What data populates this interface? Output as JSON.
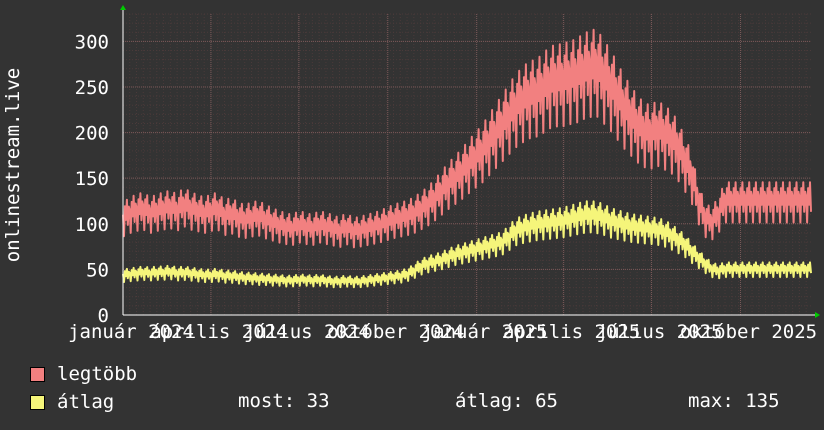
{
  "chart_data": {
    "type": "line",
    "ylabel": "onlinestream.live",
    "yticks": [
      0,
      50,
      100,
      150,
      200,
      250,
      300
    ],
    "ylim": [
      0,
      330
    ],
    "xticks": [
      "január 2024",
      "április 2024",
      "július 2024",
      "október 2024",
      "január 2025",
      "április 2025",
      "július 2025",
      "október 2025"
    ],
    "x_start": "2024-01-01",
    "x_end": "2025-12-13",
    "grid": true,
    "legend_placement": "bottom-left",
    "colors": {
      "legtobb": "#f28080",
      "atlag": "#f5f57a",
      "grid": "#5a4848",
      "minor_grid": "#4a3a3a",
      "axis": "#ffffff",
      "arrow": "#00cc00"
    },
    "series": [
      {
        "name": "legtöbb",
        "weekly_values": [
          110,
          115,
          118,
          120,
          115,
          118,
          120,
          122,
          118,
          125,
          120,
          118,
          115,
          118,
          120,
          112,
          115,
          110,
          108,
          110,
          112,
          108,
          105,
          102,
          100,
          98,
          102,
          100,
          98,
          102,
          100,
          98,
          95,
          100,
          95,
          96,
          98,
          100,
          102,
          105,
          108,
          110,
          112,
          115,
          120,
          125,
          132,
          140,
          148,
          155,
          162,
          170,
          178,
          185,
          195,
          205,
          215,
          225,
          235,
          242,
          248,
          250,
          255,
          262,
          265,
          265,
          268,
          270,
          275,
          278,
          280,
          270,
          260,
          248,
          235,
          225,
          215,
          208,
          205,
          210,
          205,
          200,
          190,
          175,
          160,
          130,
          110,
          105,
          115,
          130
        ]
      },
      {
        "name": "átlag",
        "weekly_values": [
          45,
          46,
          47,
          48,
          47,
          48,
          48,
          49,
          47,
          48,
          47,
          46,
          45,
          45,
          46,
          44,
          44,
          43,
          42,
          42,
          41,
          41,
          40,
          40,
          39,
          39,
          40,
          40,
          39,
          40,
          39,
          38,
          38,
          39,
          38,
          38,
          39,
          40,
          41,
          42,
          43,
          44,
          46,
          50,
          55,
          58,
          60,
          62,
          65,
          68,
          70,
          72,
          74,
          76,
          78,
          80,
          82,
          88,
          95,
          98,
          100,
          102,
          103,
          104,
          105,
          106,
          108,
          110,
          112,
          113,
          112,
          110,
          106,
          104,
          102,
          100,
          99,
          98,
          97,
          96,
          94,
          90,
          85,
          80,
          72,
          65,
          58,
          52,
          50,
          52
        ]
      }
    ]
  },
  "legend": {
    "items": [
      {
        "label": "legtöbb",
        "color": "#f28080"
      },
      {
        "label": "átlag",
        "color": "#f5f57a"
      }
    ]
  },
  "stats": {
    "most": "most: 33",
    "atlag": "átlag: 65",
    "max": "max: 135"
  }
}
